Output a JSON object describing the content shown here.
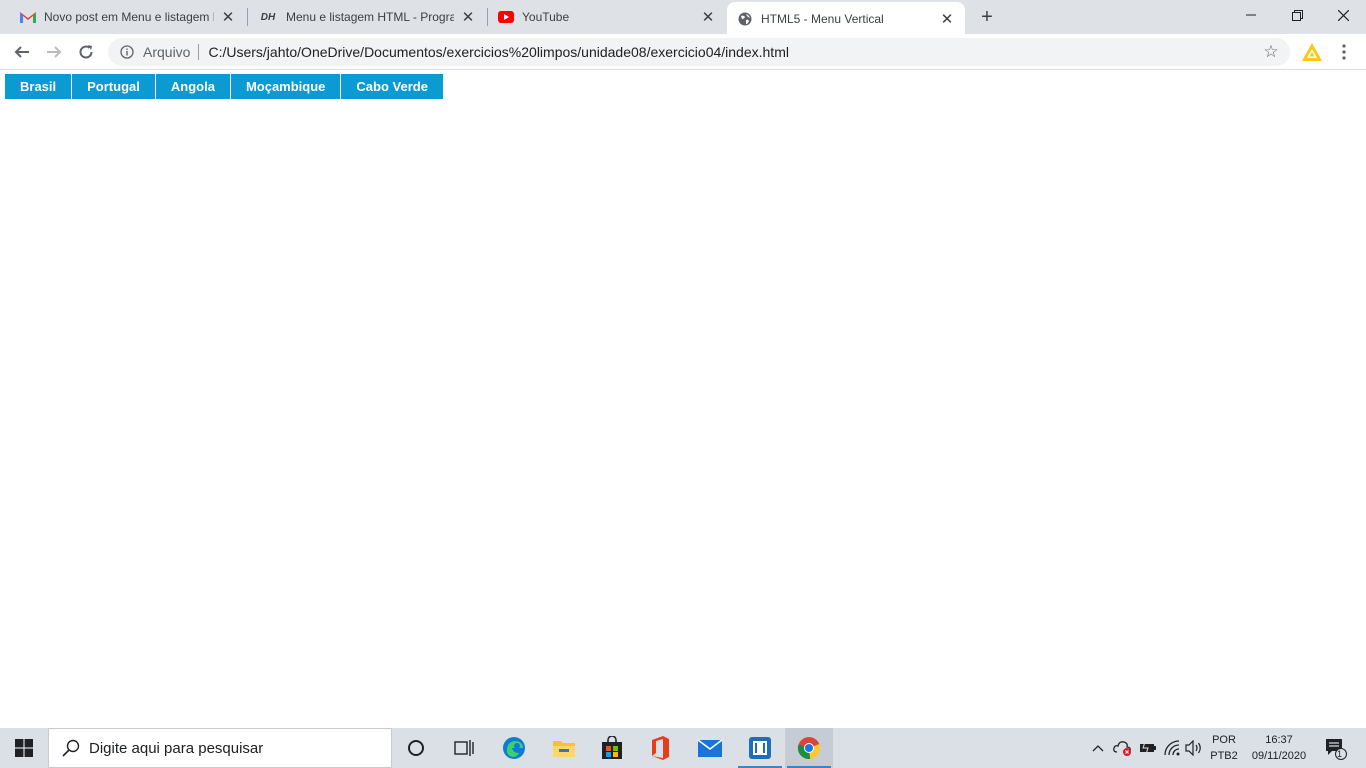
{
  "browser": {
    "tabs": [
      {
        "title": "Novo post em Menu e listagem H",
        "favicon": "gmail-icon"
      },
      {
        "title": "Menu e listagem HTML - Program",
        "favicon": "dh-icon"
      },
      {
        "title": "YouTube",
        "favicon": "youtube-icon"
      },
      {
        "title": "HTML5 - Menu Vertical",
        "favicon": "globe-icon",
        "active": true
      }
    ],
    "new_tab": "+",
    "address": {
      "scheme_label": "Arquivo",
      "url": "C:/Users/jahto/OneDrive/Documentos/exercicios%20limpos/unidade08/exercicio04/index.html"
    }
  },
  "page": {
    "menu": [
      "Brasil",
      "Portugal",
      "Angola",
      "Moçambique",
      "Cabo Verde"
    ],
    "menu_color": "#0b9ad2"
  },
  "taskbar": {
    "search_placeholder": "Digite aqui para pesquisar",
    "lang_top": "POR",
    "lang_bottom": "PTB2",
    "time": "16:37",
    "date": "09/11/2020",
    "notification_count": "1"
  }
}
